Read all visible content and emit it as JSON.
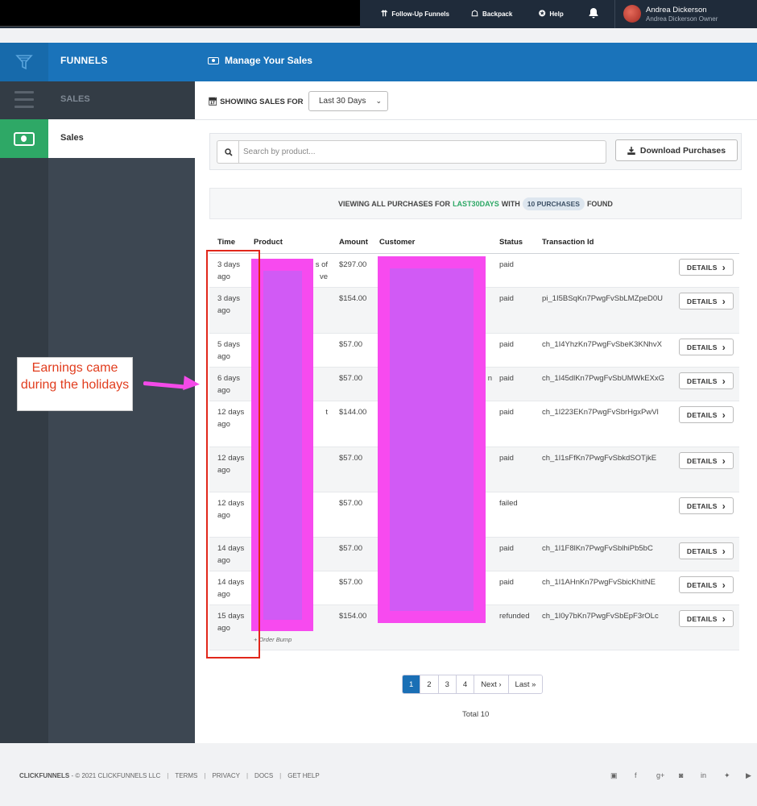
{
  "topbar": {
    "nav": [
      {
        "icon": "chevron-double-up-icon",
        "label": "Follow-Up Funnels"
      },
      {
        "icon": "backpack-icon",
        "label": "Backpack"
      },
      {
        "icon": "help-icon",
        "label": "Help"
      }
    ],
    "user": {
      "name": "Andrea Dickerson",
      "subtitle": "Andrea Dickerson  Owner"
    }
  },
  "header": {
    "funnels_title": "FUNNELS",
    "page_title": "Manage Your Sales"
  },
  "sidebar": {
    "section_title": "SALES",
    "active_item": "Sales"
  },
  "filter": {
    "label": "SHOWING SALES FOR",
    "selected": "Last 30 Days"
  },
  "search": {
    "placeholder": "Search by product...",
    "download_label": "Download Purchases"
  },
  "summary": {
    "prefix": "VIEWING ALL PURCHASES FOR",
    "period": "LAST30DAYS",
    "with": "WITH",
    "count": "10 PURCHASES",
    "suffix": "FOUND"
  },
  "table": {
    "headers": [
      "Time",
      "Product",
      "Amount",
      "Customer",
      "Status",
      "Transaction Id"
    ],
    "details_label": "DETAILS",
    "rows": [
      {
        "time": "3 days ago",
        "product_fragment": "s of\nve",
        "amount": "$297.00",
        "customer_fragment": "",
        "status": "paid",
        "txn": ""
      },
      {
        "time": "3 days ago",
        "product_fragment": "",
        "amount": "$154.00",
        "customer_fragment": "",
        "status": "paid",
        "txn": "pi_1I5BSqKn7PwgFvSbLMZpeD0U"
      },
      {
        "time": "5 days ago",
        "product_fragment": "",
        "amount": "$57.00",
        "customer_fragment": "",
        "status": "paid",
        "txn": "ch_1I4YhzKn7PwgFvSbeK3KNhvX"
      },
      {
        "time": "6 days ago",
        "product_fragment": "",
        "amount": "$57.00",
        "customer_fragment": "n",
        "status": "paid",
        "txn": "ch_1I45dlKn7PwgFvSbUMWkEXxG"
      },
      {
        "time": "12 days ago",
        "product_fragment": "t",
        "amount": "$144.00",
        "customer_fragment": "",
        "status": "paid",
        "txn": "ch_1I223EKn7PwgFvSbrHgxPwVl"
      },
      {
        "time": "12 days ago",
        "product_fragment": "",
        "amount": "$57.00",
        "customer_fragment": "",
        "status": "paid",
        "txn": "ch_1I1sFfKn7PwgFvSbkdSOTjkE"
      },
      {
        "time": "12 days ago",
        "product_fragment": "",
        "amount": "$57.00",
        "customer_fragment": "",
        "status": "failed",
        "txn": ""
      },
      {
        "time": "14 days ago",
        "product_fragment": "",
        "amount": "$57.00",
        "customer_fragment": "",
        "status": "paid",
        "txn": "ch_1I1F8lKn7PwgFvSblhiPb5bC"
      },
      {
        "time": "14 days ago",
        "product_fragment": "",
        "amount": "$57.00",
        "customer_fragment": "",
        "status": "paid",
        "txn": "ch_1I1AHnKn7PwgFvSbicKhitNE"
      },
      {
        "time": "15 days ago",
        "product_fragment": "",
        "amount": "$154.00",
        "customer_fragment": "",
        "status": "refunded",
        "txn": "ch_1I0y7bKn7PwgFvSbEpF3rOLc"
      }
    ],
    "order_bump_label": "+ Order Bump"
  },
  "annotation": {
    "note": "Earnings came during the holidays"
  },
  "pagination": {
    "pages": [
      "1",
      "2",
      "3",
      "4"
    ],
    "next": "Next ›",
    "last": "Last »",
    "current": "1",
    "total": "Total 10"
  },
  "footer": {
    "brand": "CLICKFUNNELS",
    "copyright": "- © 2021 CLICKFUNNELS LLC",
    "links": [
      "TERMS",
      "PRIVACY",
      "DOCS",
      "GET HELP"
    ],
    "social": [
      "blog-icon",
      "facebook-icon",
      "google-plus-icon",
      "instagram-icon",
      "linkedin-icon",
      "twitter-icon",
      "youtube-icon"
    ]
  },
  "colors": {
    "brand_blue": "#1a73ba",
    "success_green": "#2ea866",
    "annotation_red": "#e1271b",
    "redaction_magenta": "#f74aef"
  }
}
